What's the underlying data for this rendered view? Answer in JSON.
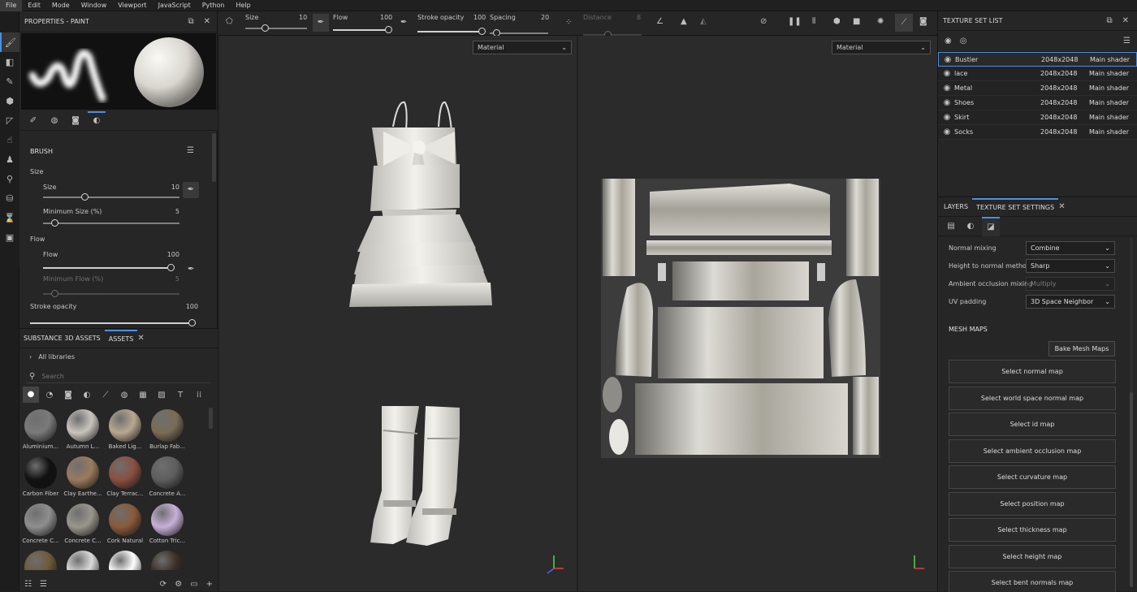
{
  "menu": [
    "File",
    "Edit",
    "Mode",
    "Window",
    "Viewport",
    "JavaScript",
    "Python",
    "Help"
  ],
  "properties": {
    "title": "PROPERTIES - PAINT",
    "section": "BRUSH",
    "size_group": "Size",
    "size_label": "Size",
    "size_value": "10",
    "min_size_label": "Minimum Size (%)",
    "min_size_value": "5",
    "flow_group": "Flow",
    "flow_label": "Flow",
    "flow_value": "100",
    "min_flow_label": "Minimum Flow (%)",
    "min_flow_value": "5",
    "stroke_label": "Stroke opacity",
    "stroke_value": "100"
  },
  "assets": {
    "tabs": [
      "SUBSTANCE 3D ASSETS",
      "ASSETS"
    ],
    "libraries": "All libraries",
    "search_placeholder": "Search",
    "items": [
      "Aluminium...",
      "Autumn L...",
      "Baked Lig...",
      "Burlap Fab...",
      "Carbon Fiber",
      "Clay Earthe...",
      "Clay Terrac...",
      "Concrete A...",
      "Concrete C...",
      "Concrete C...",
      "Cork Natural",
      "Cotton Tric...",
      "",
      "",
      "",
      ""
    ],
    "colors": [
      "#7a7a7a",
      "#c9c4bd",
      "#b8a890",
      "#7a6c55",
      "#111111",
      "#9a7a5e",
      "#8a5040",
      "#5e5e5e",
      "#8e8e8e",
      "#9a968e",
      "#8a5a3a",
      "#c8b0d8",
      "#6e5a3a",
      "#dadada",
      "#ffffff",
      "#3a3026"
    ]
  },
  "toolbar": {
    "size_label": "Size",
    "size_value": "10",
    "flow_label": "Flow",
    "flow_value": "100",
    "stroke_label": "Stroke opacity",
    "stroke_value": "100",
    "spacing_label": "Spacing",
    "spacing_value": "20",
    "distance_label": "Distance",
    "distance_value": "8"
  },
  "viewport3d": {
    "dropdown": "Material"
  },
  "viewport2d": {
    "dropdown": "Material"
  },
  "texture_set_list": {
    "title": "TEXTURE SET LIST",
    "rows": [
      {
        "name": "Bustier",
        "res": "2048x2048",
        "shader": "Main shader"
      },
      {
        "name": "lace",
        "res": "2048x2048",
        "shader": "Main shader"
      },
      {
        "name": "Metal",
        "res": "2048x2048",
        "shader": "Main shader"
      },
      {
        "name": "Shoes",
        "res": "2048x2048",
        "shader": "Main shader"
      },
      {
        "name": "Skirt",
        "res": "2048x2048",
        "shader": "Main shader"
      },
      {
        "name": "Socks",
        "res": "2048x2048",
        "shader": "Main shader"
      }
    ]
  },
  "texture_set_settings": {
    "tabs": [
      "LAYERS",
      "TEXTURE SET SETTINGS"
    ],
    "normal_mixing_label": "Normal mixing",
    "normal_mixing_value": "Combine",
    "height_label": "Height to normal method",
    "height_value": "Sharp",
    "ao_label": "Ambient occlusion mixing",
    "ao_value": "Multiply",
    "uv_label": "UV padding",
    "uv_value": "3D Space Neighbor",
    "mesh_maps": "MESH MAPS",
    "bake_button": "Bake Mesh Maps",
    "maps": [
      "Select normal map",
      "Select world space normal map",
      "Select id map",
      "Select ambient occlusion map",
      "Select curvature map",
      "Select position map",
      "Select thickness map",
      "Select height map",
      "Select bent normals map"
    ]
  }
}
